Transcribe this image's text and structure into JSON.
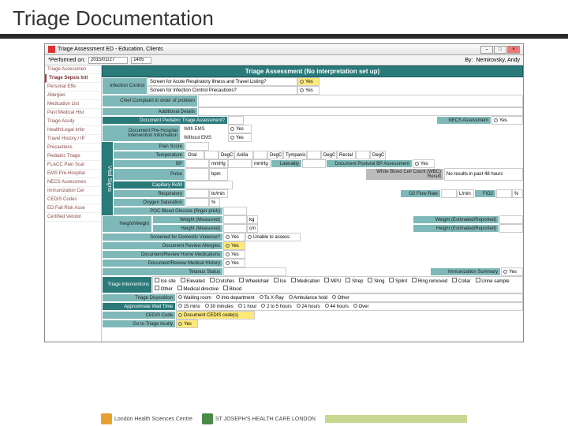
{
  "slide_title": "Triage Documentation",
  "window_title": "Triage Assessment ED - Education, Clients",
  "toolbar": {
    "performed": "*Performed on:",
    "date": "2015/01/27",
    "time": "1405",
    "by": "By:",
    "user": "Nemirovsky, Andy"
  },
  "sidebar": [
    "Triage Assessmen",
    "Triage Sepsis Init",
    "Personal Effe",
    "Allergies",
    "Medication List",
    "Past Medical Hist",
    "Triage Acuity",
    "Health/Legal Infor",
    "Travel History / IP",
    "Precautions",
    "Pediatric Triage",
    "FLACC Pain Scal",
    "EMS Pre-Hospital",
    "NECS Assessmen",
    "Immunization Cer",
    "CEDIS Codes",
    "ED Fall Risk Asse",
    "Certified Vendor"
  ],
  "header": "Triage Assessment (No interpretation set up)",
  "r1": {
    "l": "Infection Control",
    "q1": "Screen for Acute Respiratory Illness and Travel Listing?",
    "q2": "Screen for Infection Control Precautions?",
    "yes": "Yes"
  },
  "r2": {
    "l": "Chief Complaint in order of problem"
  },
  "r3": {
    "l": "Additional Details"
  },
  "r4": {
    "l": "Document Pediatric Triage Assessment?",
    "r": "NECS Assessment",
    "yes": "Yes"
  },
  "r5": {
    "l": "Document Pre-Hospital Intervention Information",
    "a": "With EMS",
    "b": "Without EMS",
    "yes": "Yes"
  },
  "vitals_label": "Vital Signs",
  "vitals": {
    "pain": "Pain Score",
    "temp": {
      "l": "Temperature",
      "oral": "Oral",
      "u1": "DegC",
      "axilla": "Axilla",
      "u2": "DegC",
      "tymp": "Tympanic",
      "u3": "DegC",
      "rectal": "Rectal",
      "u4": "DegC"
    },
    "bp": {
      "l": "BP",
      "u": "mmHg",
      "u2": "mmHg",
      "later": "Laterality",
      "doc": "Document Postural BP Assessment",
      "yes": "Yes"
    },
    "pulse": {
      "l": "Pulse",
      "u": "bpm",
      "wbc": "White Blood Cell Count (WBC) Result",
      "nores": "No results in past 48 hours"
    },
    "cap": {
      "l": "Capillary Refill"
    },
    "resp": {
      "l": "Respiratory",
      "u": "br/min",
      "o2": "O2 Flow Rate",
      "lmin": "L/min",
      "fio2": "FiO2",
      "pct": "%"
    },
    "o2sat": {
      "l": "Oxygen Saturation",
      "u": "%"
    },
    "poc": {
      "l": "POC Blood Glucose (finger prick)"
    }
  },
  "hw": {
    "l": "Height/Weight",
    "wm": "Weight (Measured)",
    "kg": "kg",
    "we": "Weight (Estimated/Reported)",
    "hm": "Height (Measured)",
    "cm": "cm",
    "he": "Height (Estimated/Reported)"
  },
  "dv": {
    "l": "Screened for Domestic Violence?",
    "yes": "Yes",
    "unable": "Unable to assess"
  },
  "da": {
    "l": "Document Review Allergies",
    "yes": "Yes"
  },
  "dm": {
    "l": "Document/Review Home Medications",
    "yes": "Yes"
  },
  "dh": {
    "l": "Document/Review Medical History",
    "yes": "Yes"
  },
  "tet": {
    "l": "Tetanus Status",
    "imm": "Immunization Summary",
    "yes": "Yes"
  },
  "ti": {
    "l": "Triage Interventions",
    "opts": [
      "Ice site",
      "Elevated",
      "Crutches",
      "Wheelchair",
      "Ice",
      "Medication",
      "MPU",
      "Strep",
      "Sling",
      "Splint",
      "Ring removed",
      "Collar",
      "Urine sample",
      "Other",
      "Medical directive",
      "Blood"
    ]
  },
  "td": {
    "l": "Triage Disposition",
    "opts": [
      "Waiting room",
      "Into department",
      "To X-Ray",
      "Ambulance hold",
      "Other"
    ]
  },
  "aw": {
    "l": "Approximate Wait Time",
    "opts": [
      "15 mins",
      "30 minutes",
      "1 hour",
      "2 to 5 hours",
      "24 hours",
      "44 hours",
      "Over"
    ]
  },
  "cedis": {
    "l": "CEDIS Code",
    "btn": "Document CEDIS code(s)"
  },
  "gta": {
    "l": "Go to Triage Acuity",
    "yes": "Yes"
  },
  "logos": {
    "lh": "London Health Sciences Centre",
    "sj": "ST JOSEPH'S HEALTH CARE LONDON"
  }
}
